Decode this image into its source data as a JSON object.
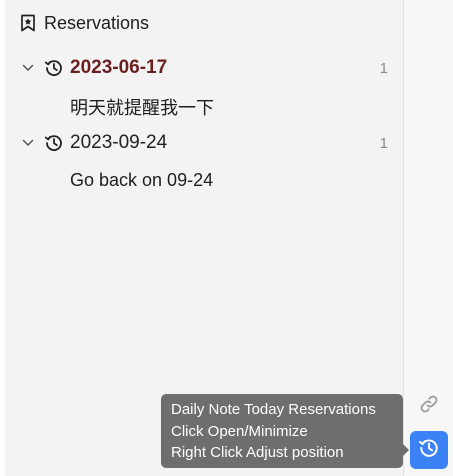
{
  "panel": {
    "title": "Reservations",
    "title_icon": "bookmark-star-icon"
  },
  "groups": [
    {
      "date": "2023-06-17",
      "count": "1",
      "is_today": true,
      "expanded": true,
      "items": [
        "明天就提醒我一下"
      ]
    },
    {
      "date": "2023-09-24",
      "count": "1",
      "is_today": false,
      "expanded": true,
      "items": [
        "Go back on 09-24"
      ]
    }
  ],
  "rail": {
    "link_icon": "link-icon",
    "fab_icon": "history-icon",
    "fab_color": "#3b82f6"
  },
  "tooltip": {
    "line1": "Daily Note Today Reservations",
    "line2": "Click Open/Minimize",
    "line3": "Right Click Adjust position"
  },
  "colors": {
    "today_date": "#6b1f1f",
    "tooltip_bg": "#6e6e6e"
  }
}
